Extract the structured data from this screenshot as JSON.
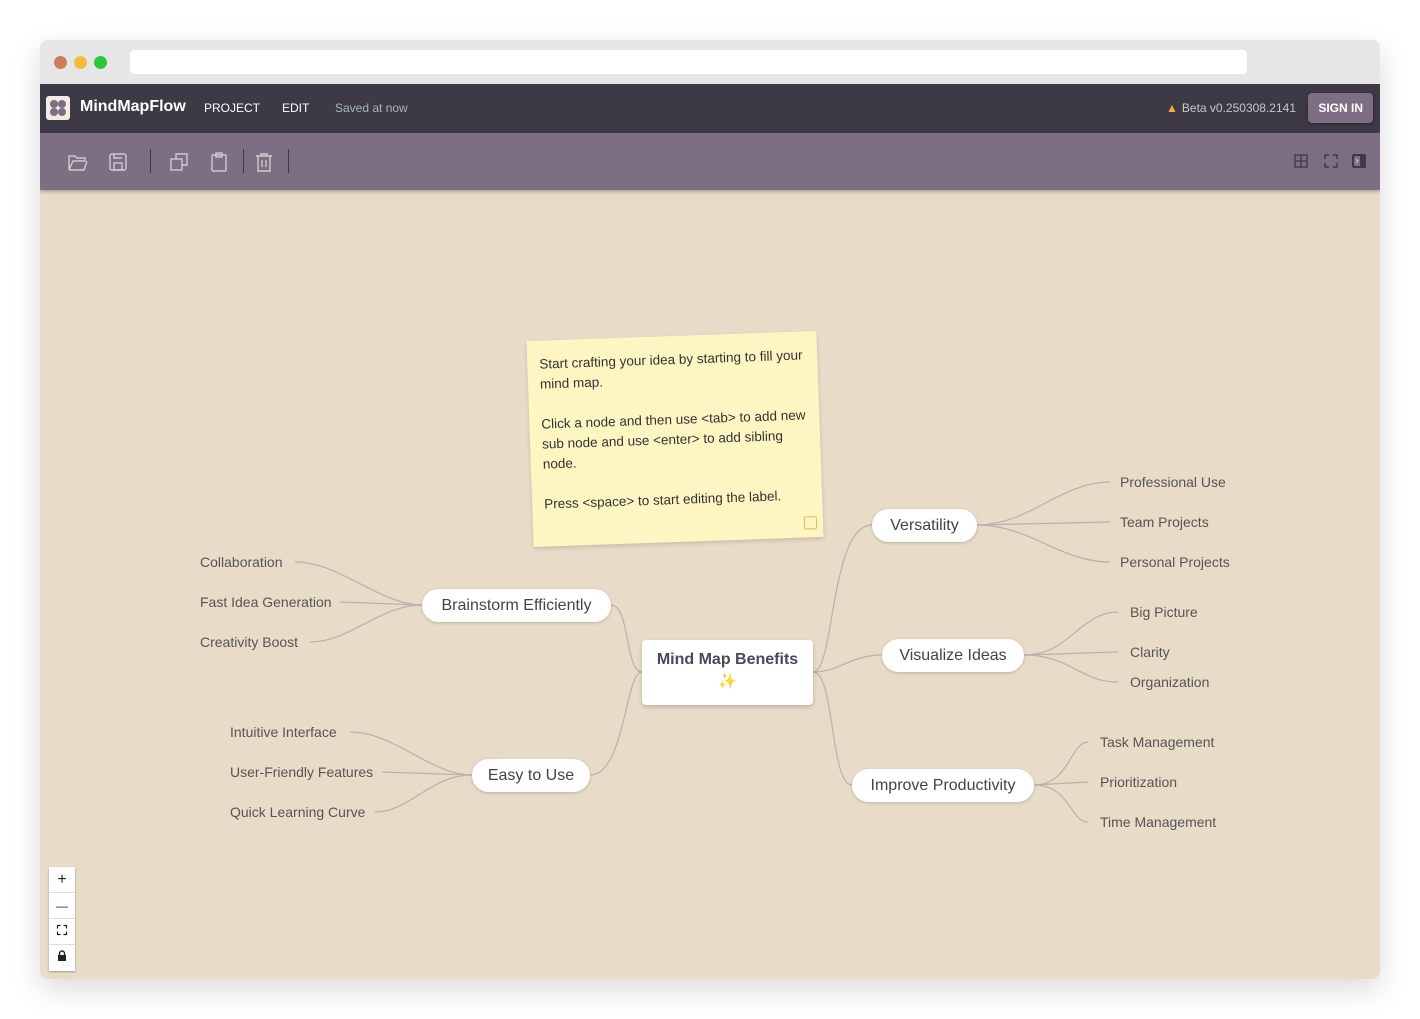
{
  "app": {
    "title": "MindMapFlow",
    "menu": [
      "PROJECT",
      "EDIT"
    ],
    "status": "Saved at now",
    "version": "Beta v0.250308.2141",
    "sign_in": "SIGN IN"
  },
  "toolbar": {
    "icons": [
      "folder-open-icon",
      "save-icon",
      "copy-icon",
      "paste-icon",
      "delete-icon",
      "grid-icon",
      "fullscreen-icon",
      "panel-toggle-icon"
    ]
  },
  "note": {
    "paragraphs": [
      "Start crafting your idea by starting to fill your mind map.",
      "Click a node and then use <tab> to add new sub node and use <enter> to add sibling node.",
      "Press <space>  to start editing the label."
    ]
  },
  "map": {
    "root": {
      "label": "Mind Map Benefits",
      "emoji": "✨"
    },
    "branches": [
      {
        "label": "Brainstorm Efficiently",
        "children": [
          "Collaboration",
          "Fast Idea Generation",
          "Creativity Boost"
        ]
      },
      {
        "label": "Easy to Use",
        "children": [
          "Intuitive Interface",
          "User-Friendly Features",
          "Quick Learning Curve"
        ]
      },
      {
        "label": "Versatility",
        "children": [
          "Professional Use",
          "Team Projects",
          "Personal Projects"
        ]
      },
      {
        "label": "Visualize Ideas",
        "children": [
          "Big Picture",
          "Clarity",
          "Organization"
        ]
      },
      {
        "label": "Improve Productivity",
        "children": [
          "Task Management",
          "Prioritization",
          "Time Management"
        ]
      }
    ]
  },
  "zoom_controls": {
    "zoom_in": "+",
    "zoom_out": "—"
  },
  "colors": {
    "header": "#3d3a45",
    "toolbar": "#7d6e83",
    "canvas": "#e8dcc8",
    "note": "#fdf6c2"
  }
}
